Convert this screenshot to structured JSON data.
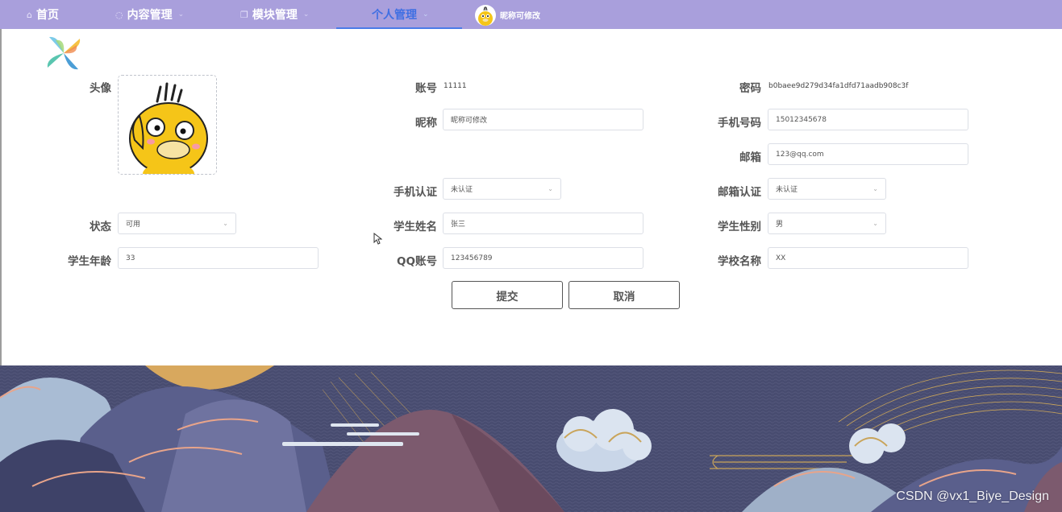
{
  "nav": {
    "items": [
      {
        "label": "首页",
        "icon": "home-icon"
      },
      {
        "label": "内容管理",
        "icon": "message-icon"
      },
      {
        "label": "模块管理",
        "icon": "copy-icon"
      },
      {
        "label": "个人管理",
        "icon": ""
      }
    ],
    "user_name": "昵称可修改",
    "active_color": "#3f6fe3",
    "bg_color": "#a99fdc"
  },
  "form": {
    "avatar_label": "头像",
    "account_label": "账号",
    "account_value": "11111",
    "password_label": "密码",
    "password_value": "b0baee9d279d34fa1dfd71aadb908c3f",
    "nickname_label": "昵称",
    "nickname_value": "昵称可修改",
    "phone_label": "手机号码",
    "phone_value": "15012345678",
    "email_label": "邮箱",
    "email_value": "123@qq.com",
    "phone_verify_label": "手机认证",
    "phone_verify_value": "未认证",
    "email_verify_label": "邮箱认证",
    "email_verify_value": "未认证",
    "status_label": "状态",
    "status_value": "可用",
    "student_name_label": "学生姓名",
    "student_name_value": "张三",
    "student_gender_label": "学生性别",
    "student_gender_value": "男",
    "student_age_label": "学生年龄",
    "student_age_value": "33",
    "qq_label": "QQ账号",
    "qq_value": "123456789",
    "school_label": "学校名称",
    "school_value": "XX",
    "submit_label": "提交",
    "cancel_label": "取消"
  },
  "watermark": "CSDN @vx1_Biye_Design"
}
